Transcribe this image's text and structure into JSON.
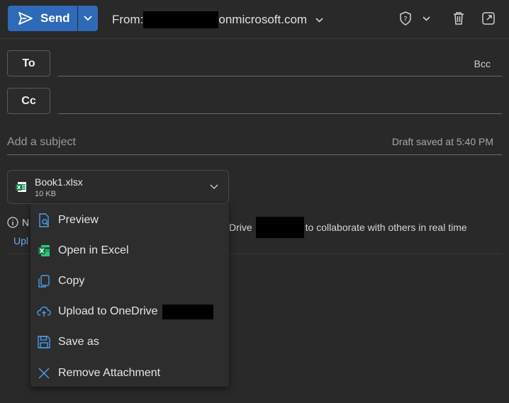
{
  "toolbar": {
    "send_label": "Send",
    "from_label": "From:",
    "from_domain": "onmicrosoft.com"
  },
  "recipients": {
    "to_label": "To",
    "cc_label": "Cc",
    "bcc_label": "Bcc"
  },
  "subject": {
    "placeholder": "Add a subject",
    "draft_status": "Draft saved at 5:40 PM"
  },
  "attachment": {
    "name": "Book1.xlsx",
    "size": "10 KB"
  },
  "info_bar": {
    "prefix": "N",
    "mid_text": "Drive",
    "suffix": "to collaborate with others in real time",
    "upload_link": "Upl"
  },
  "menu": {
    "items": [
      {
        "label": "Preview",
        "icon": "preview-icon"
      },
      {
        "label": "Open in Excel",
        "icon": "excel-icon"
      },
      {
        "label": "Copy",
        "icon": "copy-icon"
      },
      {
        "label": "Upload to OneDrive",
        "icon": "cloud-upload-icon"
      },
      {
        "label": "Save as",
        "icon": "save-icon"
      },
      {
        "label": "Remove Attachment",
        "icon": "close-icon"
      }
    ]
  },
  "colors": {
    "accent": "#2f6ab8",
    "icon_blue": "#4f9be8",
    "excel_green": "#21a366",
    "background": "#292929"
  }
}
